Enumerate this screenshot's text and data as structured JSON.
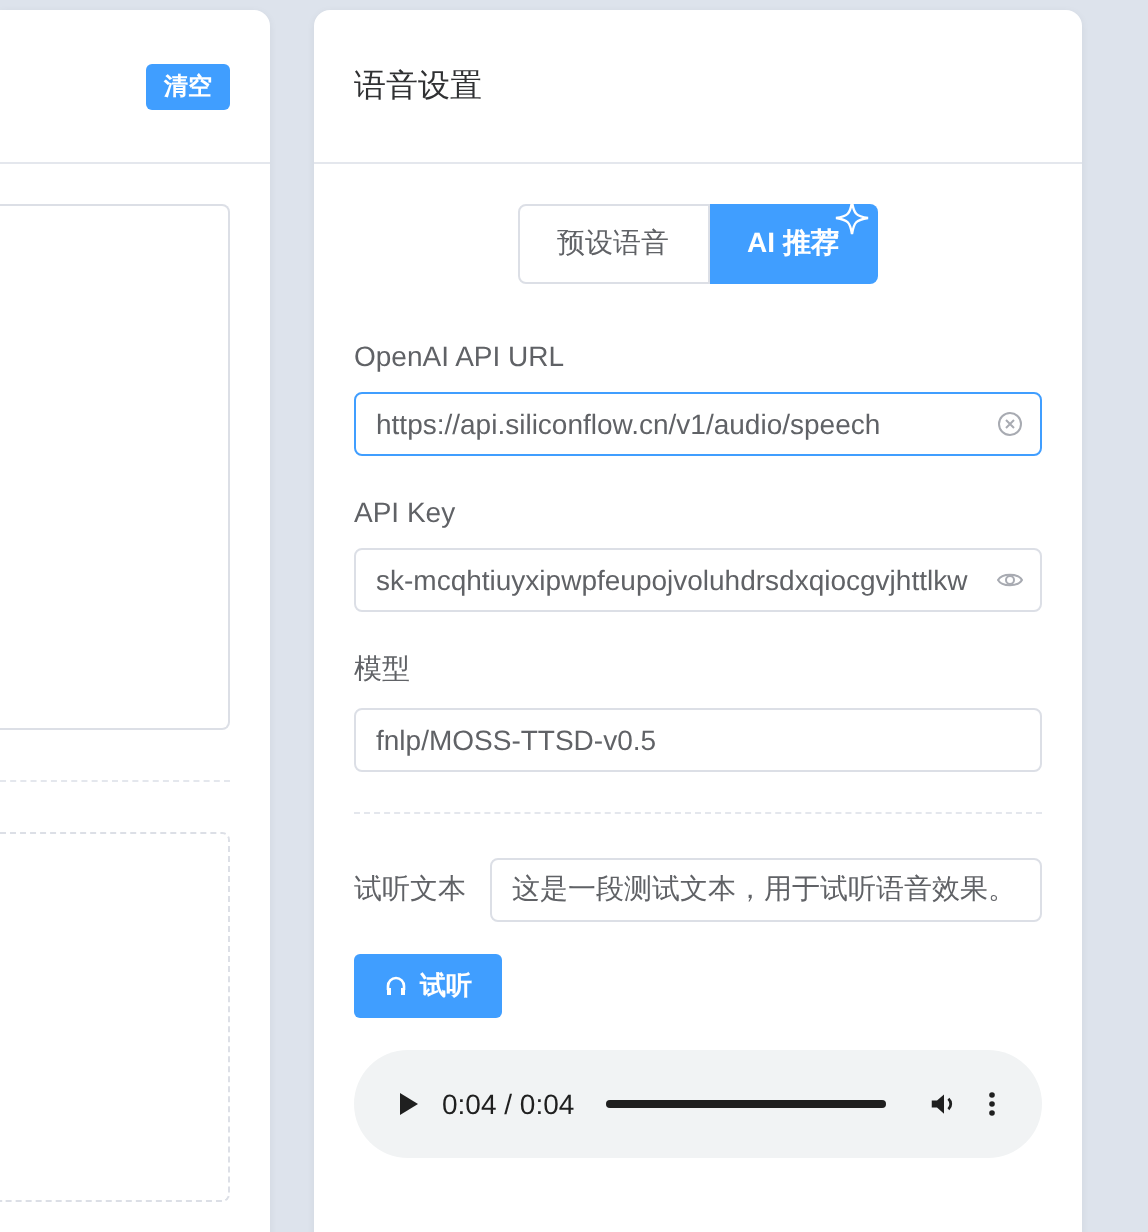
{
  "left_panel": {
    "clear_button": "清空"
  },
  "voice_settings": {
    "title": "语音设置",
    "tabs": [
      {
        "label": "预设语音",
        "selected": false
      },
      {
        "label": "AI 推荐",
        "selected": true
      }
    ],
    "fields": [
      {
        "label": "OpenAI API URL",
        "value": "https://api.siliconflow.cn/v1/audio/speech",
        "focused": true,
        "kind": "clearable"
      },
      {
        "label": "API Key",
        "value": "sk-mcqhtiuyxipwpfeupojvoluhdrsdxqiocgvjhttlkw",
        "focused": false,
        "kind": "password"
      },
      {
        "label": "模型",
        "value": "fnlp/MOSS-TTSD-v0.5",
        "focused": false,
        "kind": "plain"
      }
    ],
    "sample_text": {
      "label": "试听文本",
      "value": "这是一段测试文本，用于试听语音效果。"
    },
    "listen_button": "试听",
    "audio_player": {
      "time": "0:04 / 0:04",
      "level": 1
    }
  }
}
